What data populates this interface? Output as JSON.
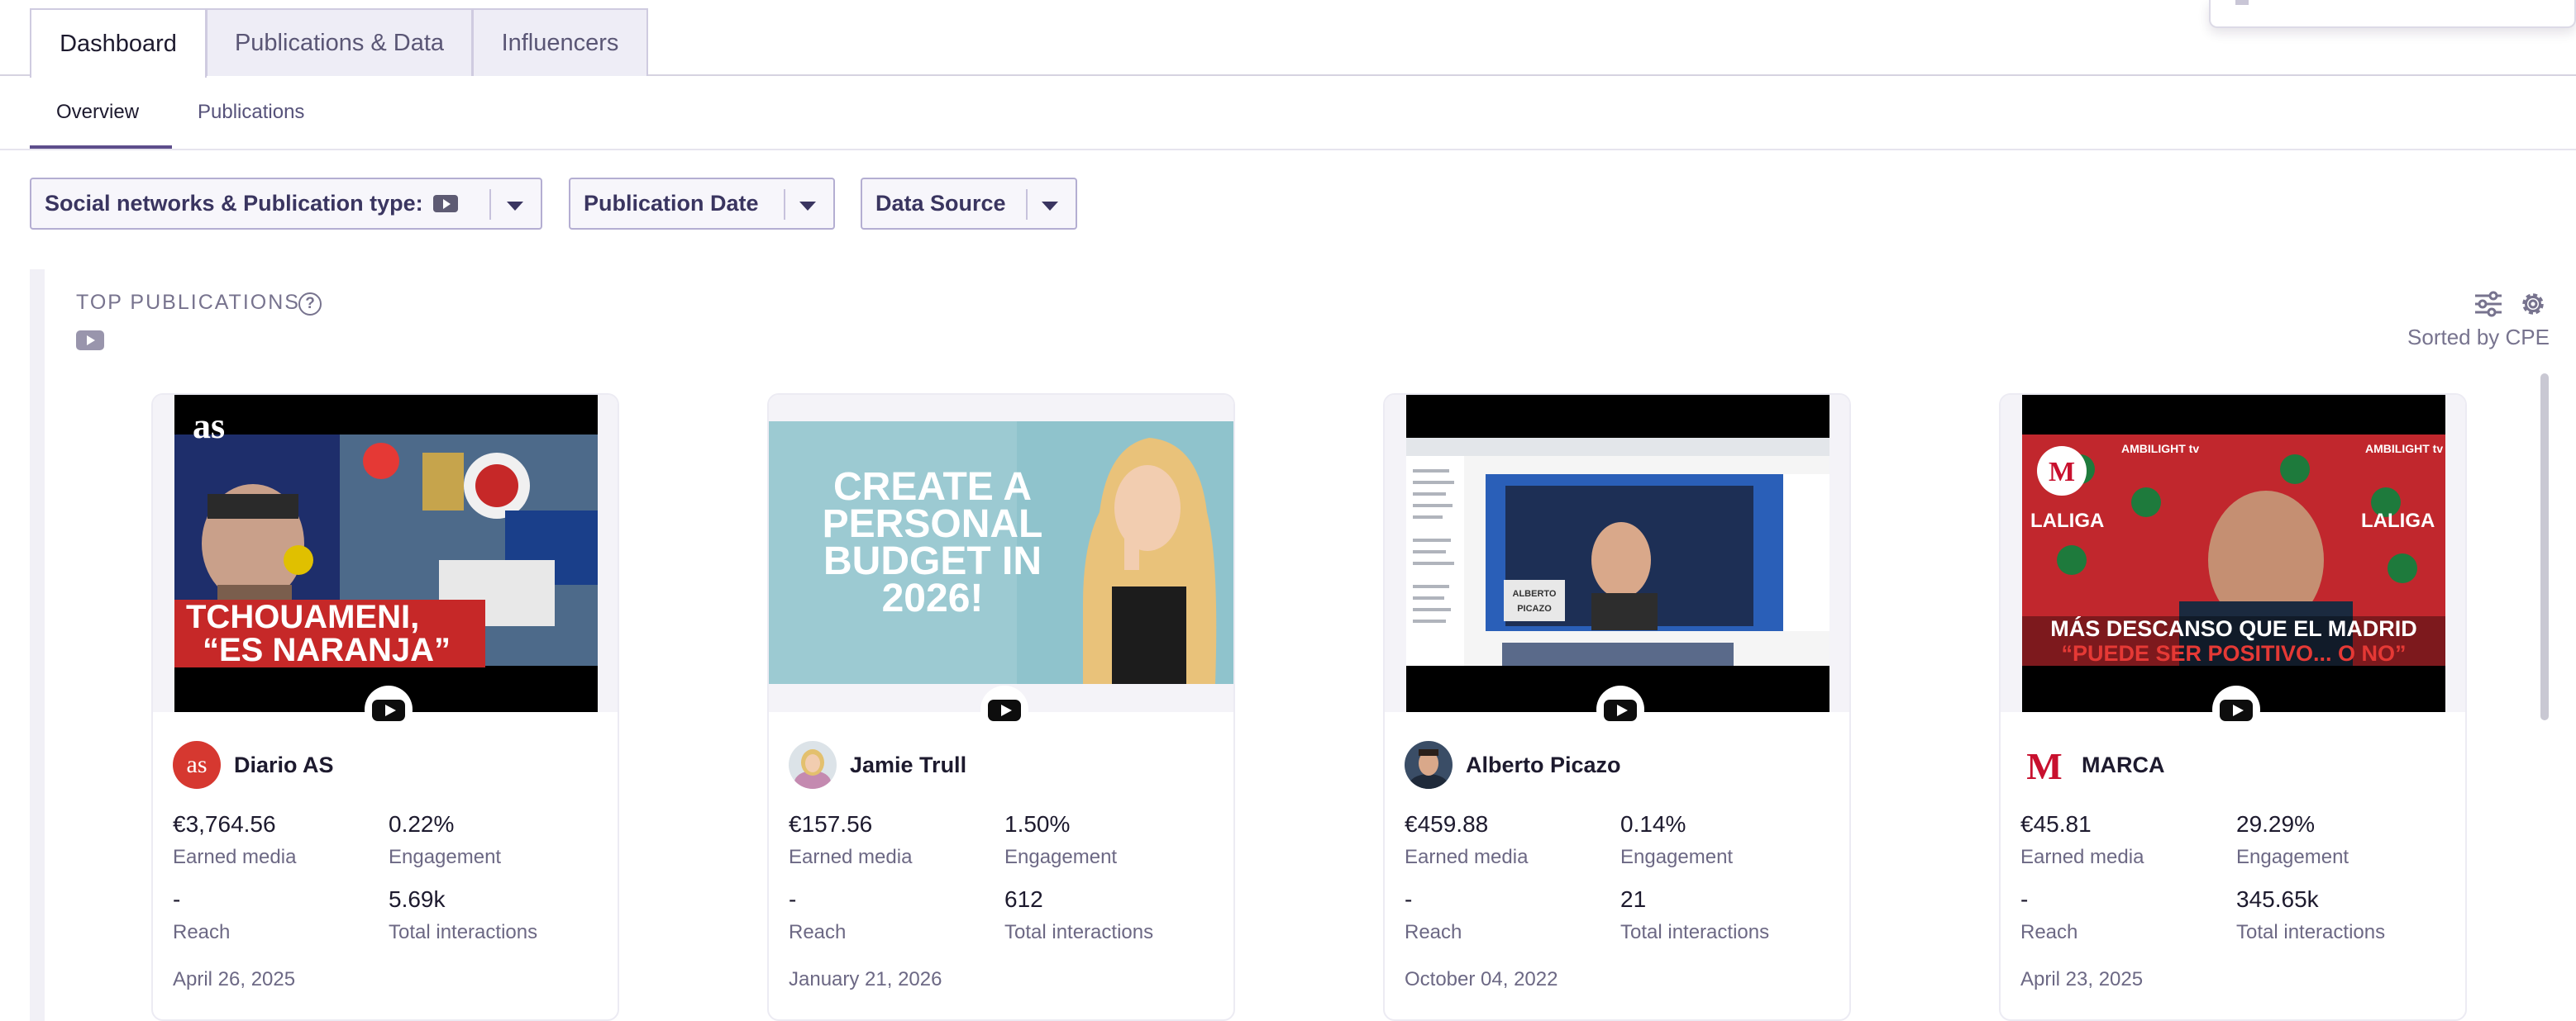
{
  "tabs": [
    {
      "label": "Dashboard",
      "active": true
    },
    {
      "label": "Publications & Data",
      "active": false
    },
    {
      "label": "Influencers",
      "active": false
    }
  ],
  "subtabs": [
    {
      "label": "Overview",
      "active": true
    },
    {
      "label": "Publications",
      "active": false
    }
  ],
  "filters": {
    "social": "Social networks & Publication type:",
    "date": "Publication Date",
    "source": "Data Source"
  },
  "section": {
    "title": "TOP PUBLICATIONS",
    "help": "?",
    "sorted": "Sorted by CPE"
  },
  "icons": {
    "youtube": "youtube-icon",
    "help": "question-circle-icon",
    "filter": "sliders-icon",
    "settings": "gear-icon",
    "dropdown": "caret-down-icon"
  },
  "colors": {
    "accent": "#5d4e8c",
    "muted_text": "#6c6884",
    "diario_as_brand": "#d63830",
    "marca_brand": "#c8102e"
  },
  "cards": [
    {
      "author": "Diario AS",
      "earned_media": "€3,764.56",
      "earned_media_label": "Earned media",
      "engagement": "0.22%",
      "engagement_label": "Engagement",
      "reach": "-",
      "reach_label": "Reach",
      "interactions": "5.69k",
      "interactions_label": "Total interactions",
      "date": "April 26, 2025",
      "thumb": {
        "logo": "as",
        "caption_1": "TCHOUAMENI,",
        "caption_2": "“ES NARANJA”"
      }
    },
    {
      "author": "Jamie Trull",
      "earned_media": "€157.56",
      "earned_media_label": "Earned media",
      "engagement": "1.50%",
      "engagement_label": "Engagement",
      "reach": "-",
      "reach_label": "Reach",
      "interactions": "612",
      "interactions_label": "Total interactions",
      "date": "January 21, 2026",
      "thumb": {
        "lines": [
          "CREATE A",
          "PERSONAL",
          "BUDGET IN",
          "2026!"
        ]
      }
    },
    {
      "author": "Alberto Picazo",
      "earned_media": "€459.88",
      "earned_media_label": "Earned media",
      "engagement": "0.14%",
      "engagement_label": "Engagement",
      "reach": "-",
      "reach_label": "Reach",
      "interactions": "21",
      "interactions_label": "Total interactions",
      "date": "October 04, 2022",
      "thumb": {
        "sign_1": "ALBERTO",
        "sign_2": "PICAZO"
      }
    },
    {
      "author": "MARCA",
      "earned_media": "€45.81",
      "earned_media_label": "Earned media",
      "engagement": "29.29%",
      "engagement_label": "Engagement",
      "reach": "-",
      "reach_label": "Reach",
      "interactions": "345.65k",
      "interactions_label": "Total interactions",
      "date": "April 23, 2025",
      "thumb": {
        "logo": "M",
        "caption_1": "MÁS DESCANSO QUE EL MADRID",
        "caption_2": "“PUEDE SER POSITIVO... O NO”",
        "board_1": "LALIGA",
        "board_2": "AMBILIGHT tv"
      }
    }
  ]
}
